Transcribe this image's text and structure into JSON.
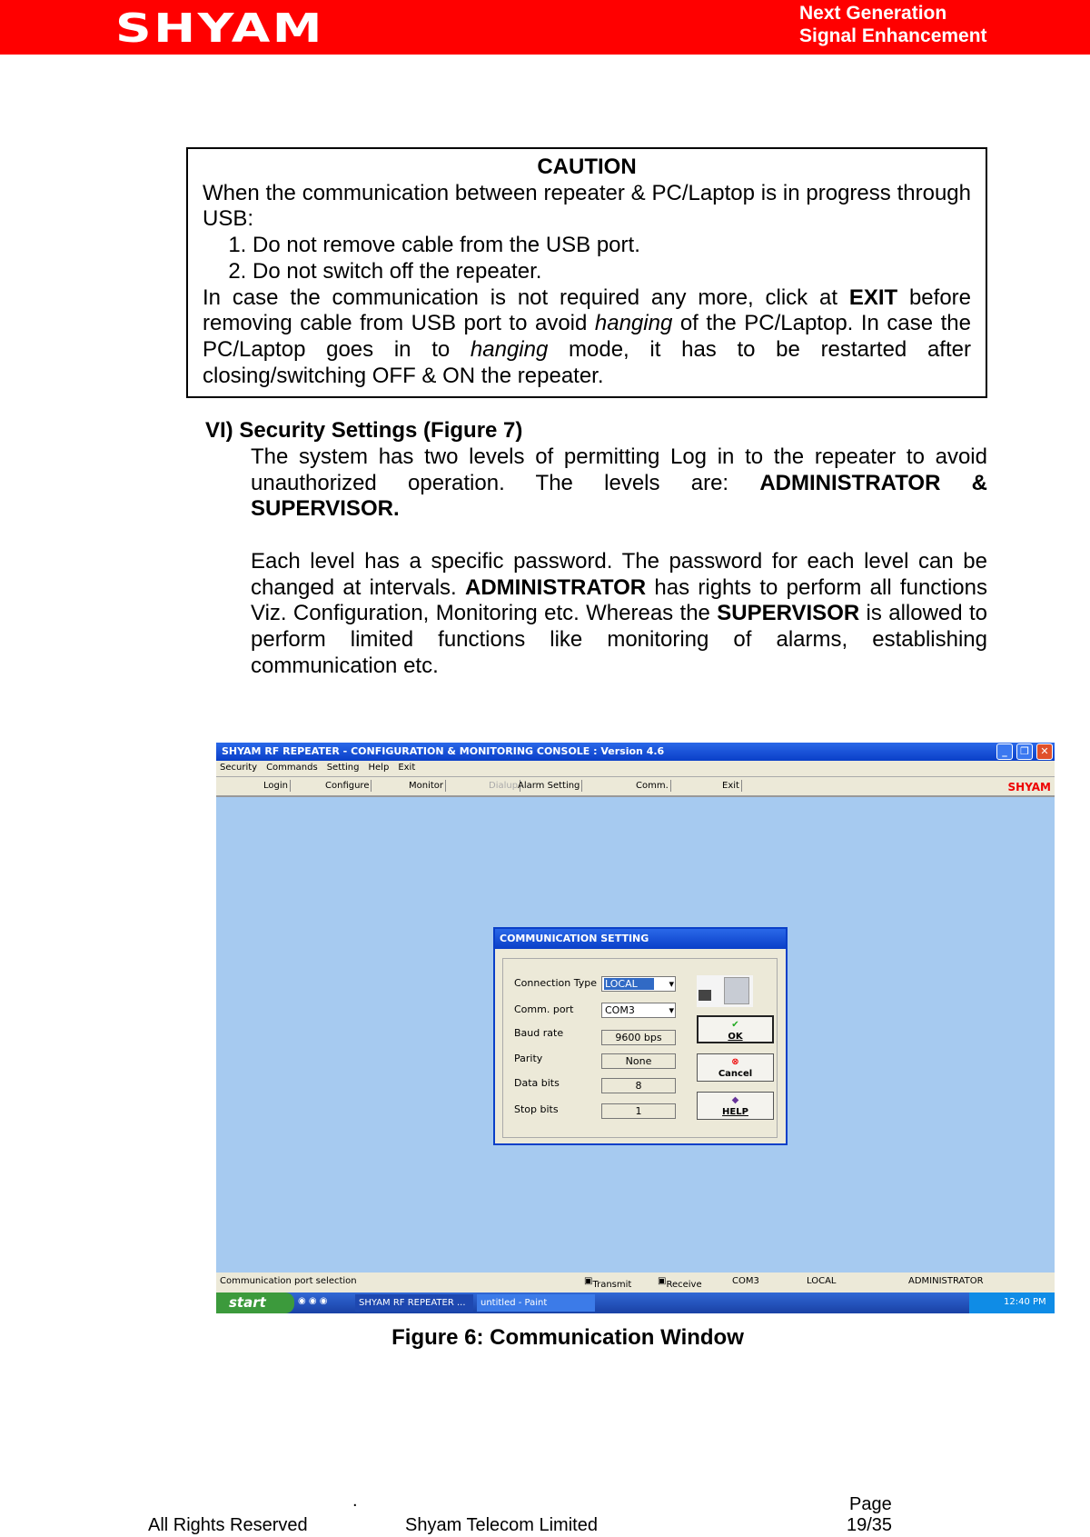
{
  "header": {
    "logo": "SHYAM",
    "tagline_1": "Next Generation",
    "tagline_2": "Signal Enhancement",
    "color": "#ff0000"
  },
  "caution": {
    "title": "CAUTION",
    "intro": "When the communication between repeater & PC/Laptop is in progress through USB:",
    "items": [
      "Do not remove cable from the USB port.",
      "Do not switch off the repeater."
    ],
    "p1": "In case the communication is not required any more, click at ",
    "exit": "EXIT",
    "p2": " before removing cable from USB port to avoid ",
    "hanging": "hanging",
    "p3": " of the PC/Laptop. In case the PC/Laptop goes in to ",
    "p4": " mode, it has to be restarted after closing/switching OFF & ON the repeater."
  },
  "section": {
    "heading": "VI) Security Settings (Figure 7)",
    "para1a": "The system has two levels of permitting Log in to the repeater to avoid unauthorized operation. The levels are: ",
    "para1b": "ADMINISTRATOR & SUPERVISOR.",
    "para2a": "Each level has a specific password. The password for each level can be changed at intervals. ",
    "admin": "ADMINISTRATOR",
    "para2b": " has rights to perform all functions Viz. Configuration, Monitoring etc. Whereas the ",
    "supervisor": "SUPERVISOR",
    "para2c": " is allowed to perform limited functions like monitoring of alarms, establishing communication etc."
  },
  "app": {
    "title": "SHYAM RF REPEATER - CONFIGURATION & MONITORING CONSOLE  :  Version 4.6",
    "menu": [
      "Security",
      "Commands",
      "Setting",
      "Help",
      "Exit"
    ],
    "toolbar": [
      "Login",
      "Configure",
      "Monitor",
      "Dialup",
      "Alarm Setting",
      "Comm.",
      "Exit"
    ],
    "brand": "SHYAM",
    "dialog": {
      "title": "COMMUNICATION SETTING",
      "fields": [
        {
          "label": "Connection Type",
          "value": "LOCAL"
        },
        {
          "label": "Comm. port",
          "value": "COM3"
        },
        {
          "label": "Baud rate",
          "value": "9600 bps"
        },
        {
          "label": "Parity",
          "value": "None"
        },
        {
          "label": "Data bits",
          "value": "8"
        },
        {
          "label": "Stop bits",
          "value": "1"
        }
      ],
      "ok": "OK",
      "cancel": "Cancel",
      "help": "HELP"
    },
    "status": {
      "text": "Communication port selection",
      "transmit": "Transmit",
      "receive": "Receive",
      "port": "COM3",
      "mode": "LOCAL",
      "user": "ADMINISTRATOR"
    },
    "taskbar": {
      "start": "start",
      "task1": "SHYAM RF REPEATER ...",
      "task2": "untitled - Paint",
      "clock": "12:40 PM"
    }
  },
  "caption": "Figure 6: Communication Window",
  "footer": {
    "dot": ".",
    "rights": "All Rights Reserved",
    "company": "Shyam Telecom Limited",
    "page_label": "Page",
    "page": "19/35"
  }
}
